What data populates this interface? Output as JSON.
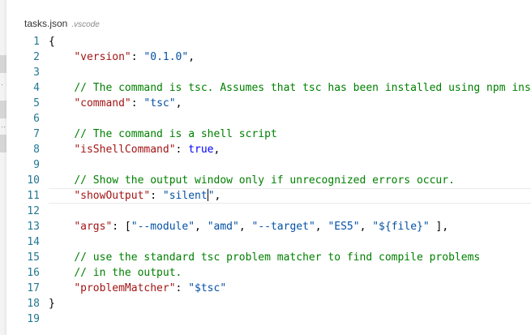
{
  "tab": {
    "filename": "tasks.json",
    "folder": ".vscode"
  },
  "code_lines": [
    {
      "n": "1",
      "tokens": [
        {
          "t": "{",
          "c": "punc"
        }
      ]
    },
    {
      "n": "2",
      "tokens": [
        {
          "t": "    ",
          "c": "punc"
        },
        {
          "t": "\"version\"",
          "c": "key"
        },
        {
          "t": ": ",
          "c": "punc"
        },
        {
          "t": "\"0.1.0\"",
          "c": "str"
        },
        {
          "t": ",",
          "c": "punc"
        }
      ]
    },
    {
      "n": "3",
      "tokens": []
    },
    {
      "n": "4",
      "tokens": [
        {
          "t": "    ",
          "c": "punc"
        },
        {
          "t": "// The command is tsc. Assumes that tsc has been installed using npm inst",
          "c": "cmt"
        }
      ]
    },
    {
      "n": "5",
      "tokens": [
        {
          "t": "    ",
          "c": "punc"
        },
        {
          "t": "\"command\"",
          "c": "key"
        },
        {
          "t": ": ",
          "c": "punc"
        },
        {
          "t": "\"tsc\"",
          "c": "str"
        },
        {
          "t": ",",
          "c": "punc"
        }
      ]
    },
    {
      "n": "6",
      "tokens": []
    },
    {
      "n": "7",
      "tokens": [
        {
          "t": "    ",
          "c": "punc"
        },
        {
          "t": "// The command is a shell script",
          "c": "cmt"
        }
      ]
    },
    {
      "n": "8",
      "tokens": [
        {
          "t": "    ",
          "c": "punc"
        },
        {
          "t": "\"isShellCommand\"",
          "c": "key"
        },
        {
          "t": ": ",
          "c": "punc"
        },
        {
          "t": "true",
          "c": "kw"
        },
        {
          "t": ",",
          "c": "punc"
        }
      ]
    },
    {
      "n": "9",
      "tokens": []
    },
    {
      "n": "10",
      "tokens": [
        {
          "t": "    ",
          "c": "punc"
        },
        {
          "t": "// Show the output window only if unrecognized errors occur.",
          "c": "cmt"
        }
      ]
    },
    {
      "n": "11",
      "active": true,
      "tokens": [
        {
          "t": "    ",
          "c": "punc"
        },
        {
          "t": "\"showOutput\"",
          "c": "key"
        },
        {
          "t": ": ",
          "c": "punc"
        },
        {
          "t": "\"silent",
          "c": "str"
        },
        {
          "t": "|cursor|",
          "c": "cursor"
        },
        {
          "t": "\"",
          "c": "str"
        },
        {
          "t": ",",
          "c": "punc"
        }
      ]
    },
    {
      "n": "12",
      "tokens": []
    },
    {
      "n": "13",
      "tokens": [
        {
          "t": "    ",
          "c": "punc"
        },
        {
          "t": "\"args\"",
          "c": "key"
        },
        {
          "t": ": [",
          "c": "punc"
        },
        {
          "t": "\"--module\"",
          "c": "str"
        },
        {
          "t": ", ",
          "c": "punc"
        },
        {
          "t": "\"amd\"",
          "c": "str"
        },
        {
          "t": ", ",
          "c": "punc"
        },
        {
          "t": "\"--target\"",
          "c": "str"
        },
        {
          "t": ", ",
          "c": "punc"
        },
        {
          "t": "\"ES5\"",
          "c": "str"
        },
        {
          "t": ", ",
          "c": "punc"
        },
        {
          "t": "\"${file}\"",
          "c": "str"
        },
        {
          "t": " ],",
          "c": "punc"
        }
      ]
    },
    {
      "n": "14",
      "tokens": []
    },
    {
      "n": "15",
      "tokens": [
        {
          "t": "    ",
          "c": "punc"
        },
        {
          "t": "// use the standard tsc problem matcher to find compile problems",
          "c": "cmt"
        }
      ]
    },
    {
      "n": "16",
      "tokens": [
        {
          "t": "    ",
          "c": "punc"
        },
        {
          "t": "// in the output.",
          "c": "cmt"
        }
      ]
    },
    {
      "n": "17",
      "tokens": [
        {
          "t": "    ",
          "c": "punc"
        },
        {
          "t": "\"problemMatcher\"",
          "c": "key"
        },
        {
          "t": ": ",
          "c": "punc"
        },
        {
          "t": "\"$tsc\"",
          "c": "str"
        }
      ]
    },
    {
      "n": "18",
      "tokens": [
        {
          "t": "}",
          "c": "punc"
        }
      ]
    },
    {
      "n": "19",
      "tokens": []
    }
  ],
  "colors": {
    "line_number": "#237893",
    "json_key": "#a31515",
    "string": "#0451a5",
    "comment": "#008000",
    "keyword": "#0000ff"
  }
}
